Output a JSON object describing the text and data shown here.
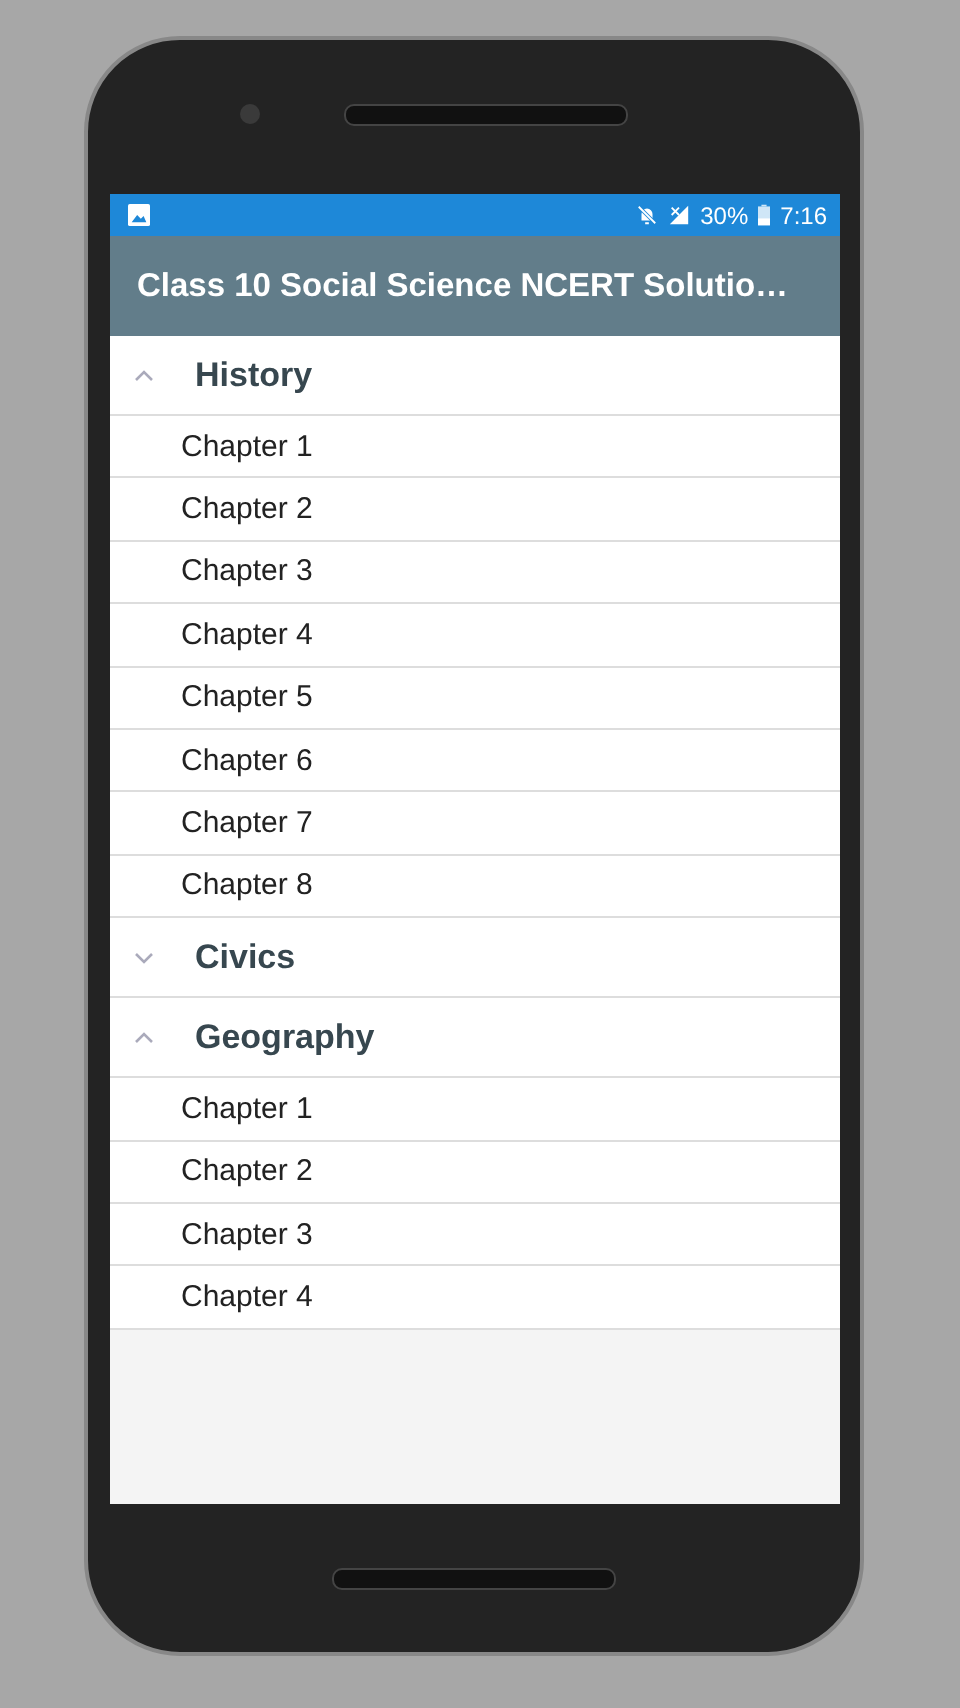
{
  "status_bar": {
    "battery": "30%",
    "time": "7:16"
  },
  "app_bar": {
    "title": "Class 10 Social Science NCERT Solutio…"
  },
  "sections": [
    {
      "title": "History",
      "expanded": true,
      "chapters": [
        "Chapter 1",
        "Chapter 2",
        "Chapter 3",
        "Chapter 4",
        "Chapter 5",
        "Chapter 6",
        "Chapter 7",
        "Chapter 8"
      ]
    },
    {
      "title": "Civics",
      "expanded": false
    },
    {
      "title": "Geography",
      "expanded": true,
      "chapters": [
        "Chapter 1",
        "Chapter 2",
        "Chapter 3",
        "Chapter 4"
      ]
    }
  ]
}
